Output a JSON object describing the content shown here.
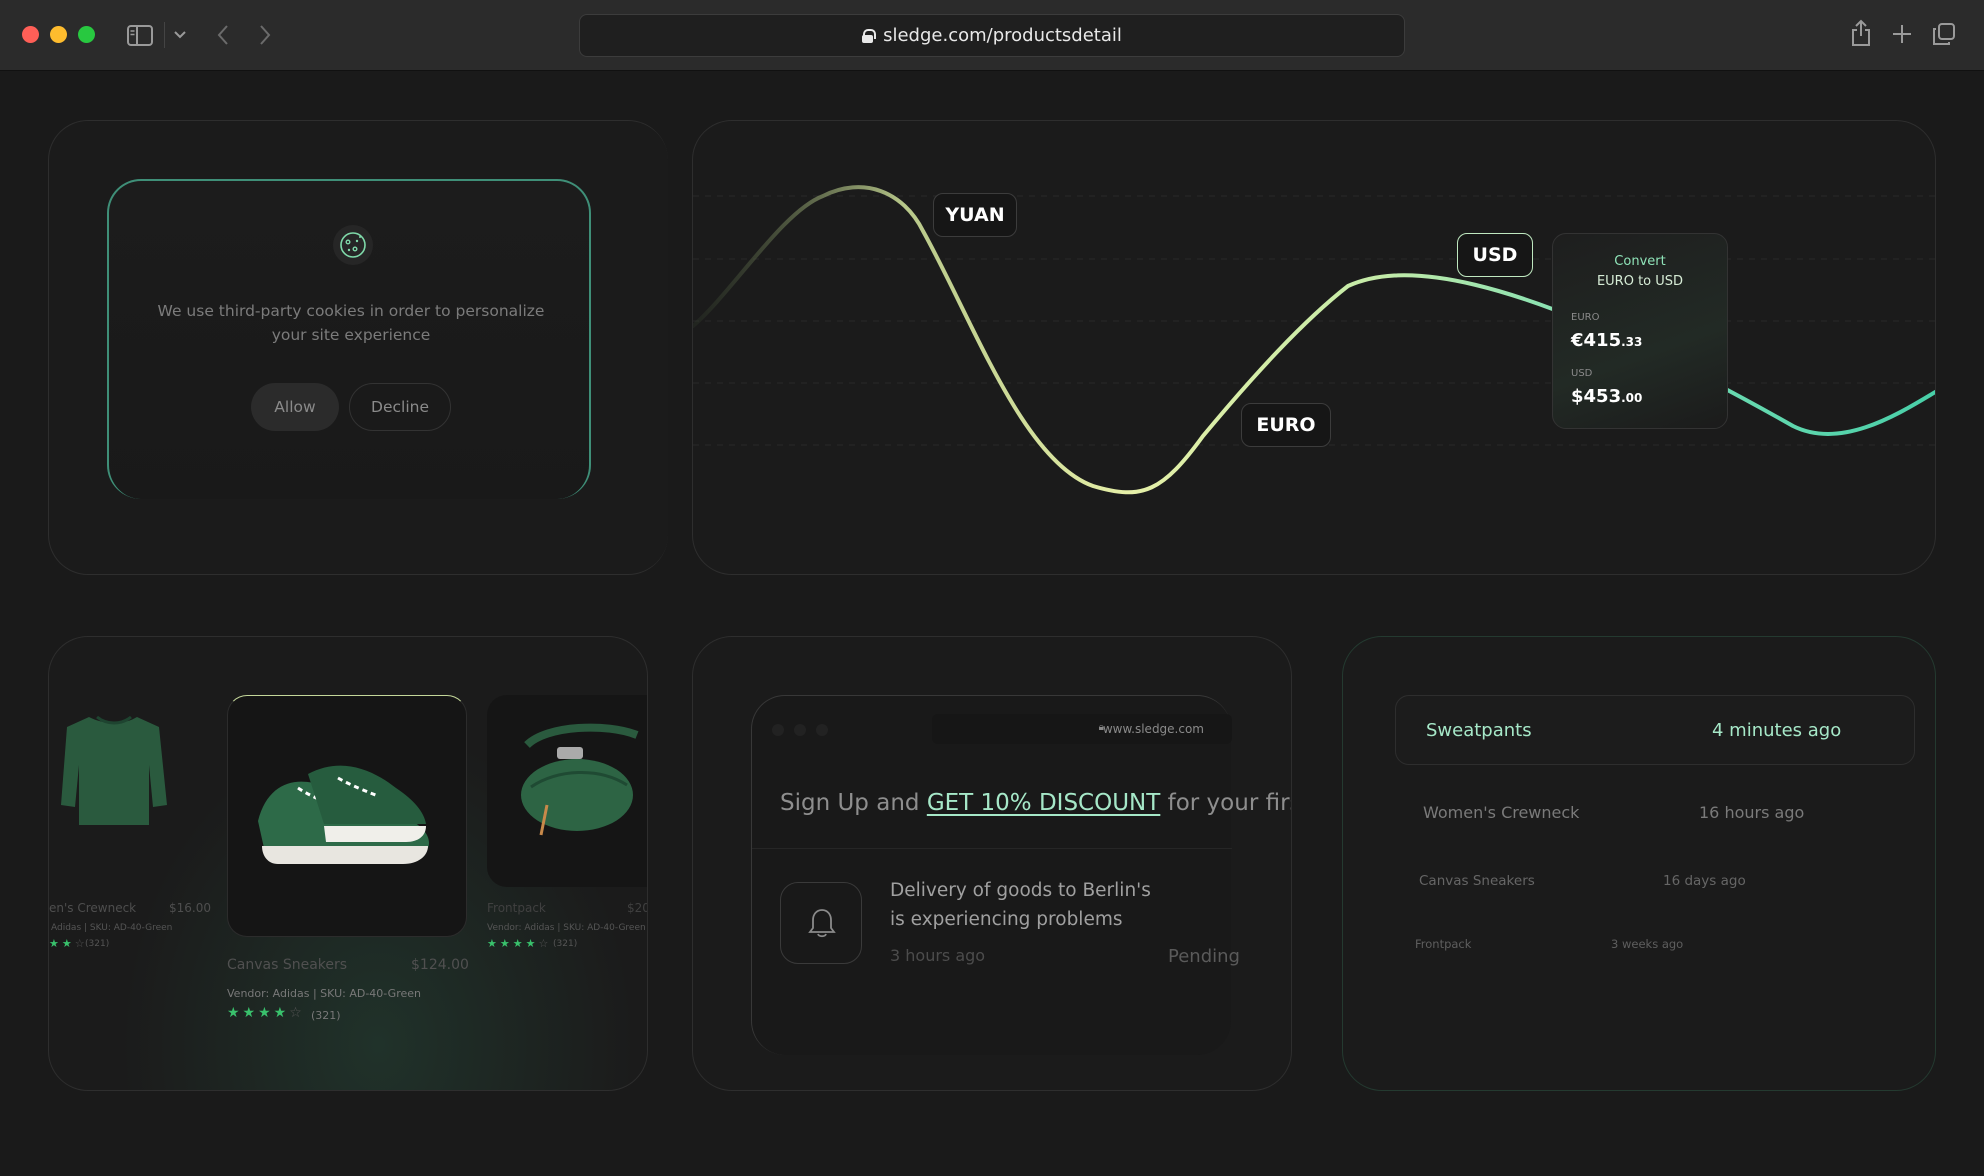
{
  "browser": {
    "url": "sledge.com/productsdetail",
    "icons": [
      "sidebar-icon",
      "chevron-down-icon",
      "back-icon",
      "forward-icon",
      "share-icon",
      "new-tab-icon",
      "tabs-overview-icon"
    ]
  },
  "cookie": {
    "message": "We use third-party cookies in order to personalize your site experience",
    "allow_label": "Allow",
    "decline_label": "Decline"
  },
  "currency": {
    "tags": {
      "yuan": "YUAN",
      "euro": "EURO",
      "usd": "USD"
    },
    "convert": {
      "title": "Convert",
      "subtitle": "EURO to USD",
      "from_label": "EURO",
      "from_main": "€415",
      "from_cents": ".33",
      "to_label": "USD",
      "to_main": "$453",
      "to_cents": ".00"
    },
    "colors": {
      "line_start": "#b5d98a",
      "line_end": "#4ad1a8",
      "accent": "#8fe3b8"
    }
  },
  "products": [
    {
      "name": "en's Crewneck",
      "price": "$16.00",
      "meta": "Adidas | SKU: AD-40-Green",
      "stars": 2,
      "reviews": "(321)"
    },
    {
      "name": "Canvas Sneakers",
      "price": "$124.00",
      "meta": "Vendor: Adidas | SKU: AD-40-Green",
      "stars": 4,
      "reviews": "(321)"
    },
    {
      "name": "Frontpack",
      "price": "$20",
      "meta": "Vendor: Adidas | SKU: AD-40-Green",
      "stars": 4,
      "reviews": "(321)"
    }
  ],
  "signup": {
    "domain": "www.sledge.com",
    "prefix": "Sign Up and ",
    "discount": "GET 10% DISCOUNT",
    "suffix": " for your first o",
    "notification": {
      "text": "Delivery of goods to Berlin's is experiencing problems",
      "time": "3 hours ago",
      "status": "Pending"
    }
  },
  "recent": [
    {
      "name": "Sweatpants",
      "time": "4 minutes ago"
    },
    {
      "name": "Women's Crewneck",
      "time": "16 hours ago"
    },
    {
      "name": "Canvas Sneakers",
      "time": "16 days ago"
    },
    {
      "name": "Frontpack",
      "time": "3 weeks ago"
    }
  ]
}
